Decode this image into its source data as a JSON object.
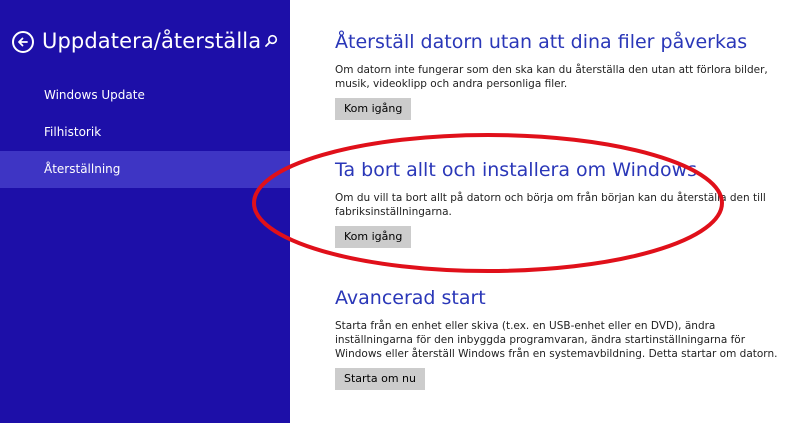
{
  "sidebar": {
    "title": "Uppdatera/återställa",
    "back_icon": "arrow-left-circle-icon",
    "search_icon": "search-icon",
    "items": [
      {
        "label": "Windows Update"
      },
      {
        "label": "Filhistorik"
      },
      {
        "label": "Återställning",
        "selected": true
      }
    ]
  },
  "main": {
    "sections": [
      {
        "title": "Återställ datorn utan att dina filer påverkas",
        "description": "Om datorn inte fungerar som den ska kan du återställa den utan att förlora bilder, musik, videoklipp och andra personliga filer.",
        "button": "Kom igång"
      },
      {
        "title": "Ta bort allt och installera om Windows",
        "description": "Om du vill ta bort allt på datorn och börja om från början kan du återställa den till fabriksinställningarna.",
        "button": "Kom igång"
      },
      {
        "title": "Avancerad start",
        "description": "Starta från en enhet eller skiva (t.ex. en USB-enhet eller en DVD), ändra inställningarna för den inbyggda programvaran, ändra startinställningarna för Windows eller återställ Windows från en systemavbildning. Detta startar om datorn.",
        "button": "Starta om nu"
      }
    ]
  },
  "colors": {
    "sidebar_bg": "#1d0fa8",
    "sidebar_selected": "#3e35c4",
    "heading": "#2a37b8",
    "button_bg": "#cccccc",
    "annotation": "#e0101a"
  }
}
